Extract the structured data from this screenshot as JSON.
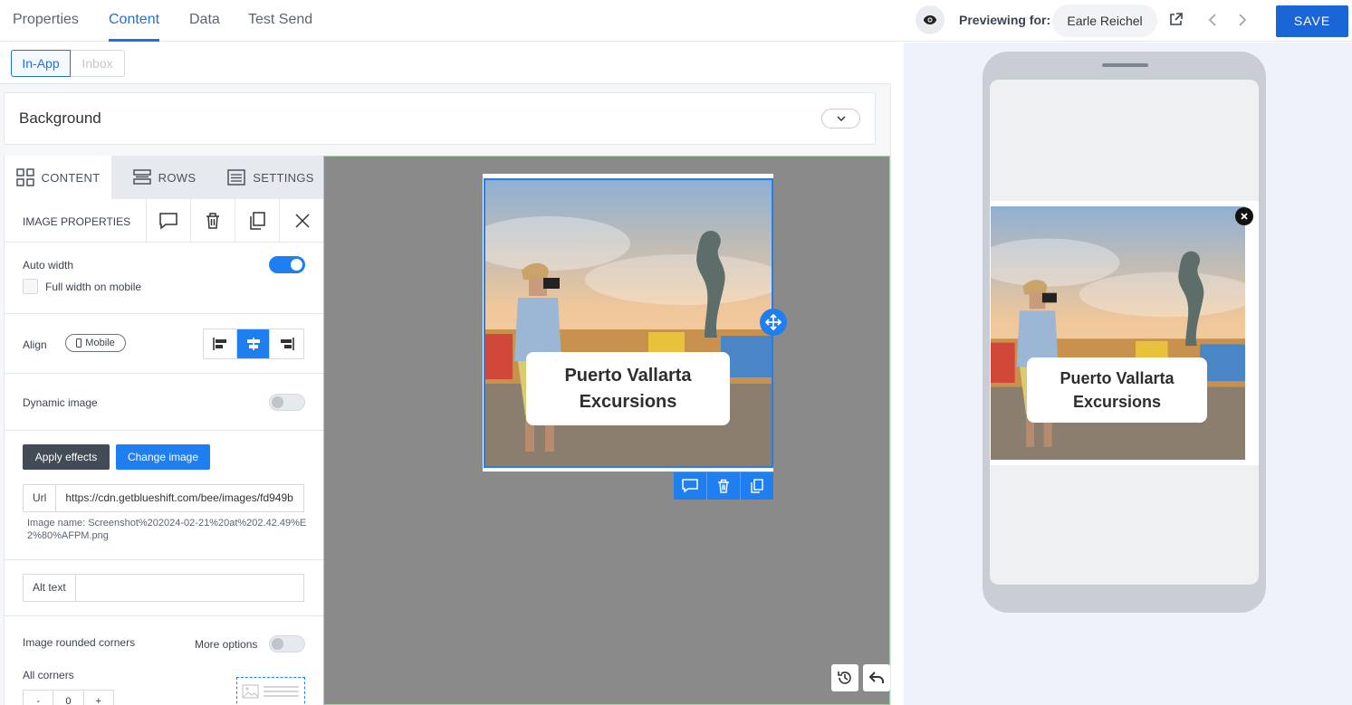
{
  "top_tabs": [
    {
      "label": "Properties",
      "active": false
    },
    {
      "label": "Content",
      "active": true
    },
    {
      "label": "Data",
      "active": false
    },
    {
      "label": "Test Send",
      "active": false
    }
  ],
  "preview": {
    "label": "Previewing for:",
    "user": "Earle Reichel"
  },
  "save_label": "SAVE",
  "sub_tabs": {
    "active": "In-App",
    "inactive": "Inbox"
  },
  "background_section": {
    "title": "Background"
  },
  "panel_tabs": [
    {
      "label": "CONTENT",
      "icon": "grid-icon",
      "active": true
    },
    {
      "label": "ROWS",
      "icon": "rows-icon",
      "active": false
    },
    {
      "label": "SETTINGS",
      "icon": "settings-list-icon",
      "active": false
    }
  ],
  "image_properties": {
    "title": "IMAGE PROPERTIES",
    "auto_width_label": "Auto width",
    "auto_width_on": true,
    "full_width_mobile_label": "Full width on mobile",
    "full_width_mobile_checked": false,
    "align_label": "Align",
    "mobile_label": "Mobile",
    "align_selected": "center",
    "dynamic_image_label": "Dynamic image",
    "dynamic_image_on": false,
    "apply_effects_label": "Apply effects",
    "change_image_label": "Change image",
    "url_label": "Url",
    "url_value": "https://cdn.getblueshift.com/bee/images/fd949b",
    "image_name": "Image name: Screenshot%202024-02-21%20at%202.42.49%E2%80%AFPM.png",
    "alt_text_label": "Alt text",
    "alt_text_value": "",
    "rounded_corners_label": "Image rounded corners",
    "more_options_label": "More options",
    "more_options_on": false,
    "all_corners_label": "All corners",
    "corner_minus": "-",
    "corner_value": "0",
    "corner_plus": "+"
  },
  "image": {
    "caption_line1": "Puerto Vallarta",
    "caption_line2": "Excursions"
  },
  "colors": {
    "accent": "#1f7ff0",
    "save": "#1a66d6",
    "canvas": "#8a8a8a"
  }
}
